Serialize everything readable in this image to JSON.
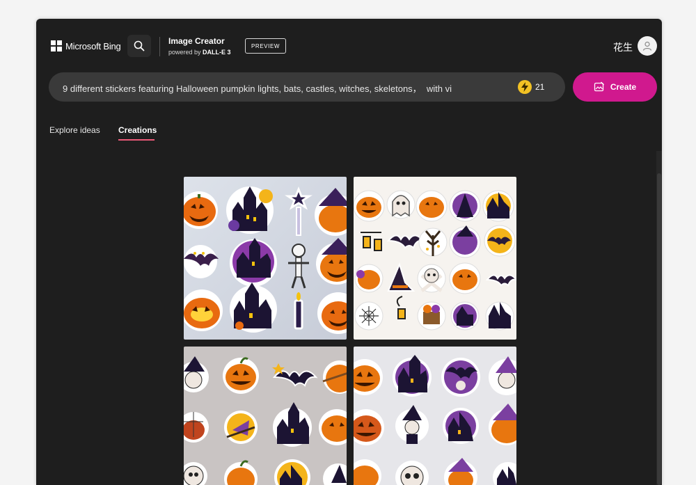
{
  "header": {
    "brand": "Microsoft Bing",
    "search_icon": "search-icon",
    "product_title": "Image Creator",
    "powered_by_prefix": "powered by ",
    "powered_by_model": "DALL-E 3",
    "badge": "PREVIEW",
    "user_name": "花生",
    "avatar_icon": "person-icon"
  },
  "prompt": {
    "text": "9 different stickers featuring Halloween pumpkin lights, bats, castles, witches, skeletons，  with vi",
    "boost_icon": "lightning-icon",
    "boosts": "21",
    "create_label": "Create",
    "create_icon": "image-create-icon"
  },
  "tabs": [
    {
      "label": "Explore ideas",
      "active": false
    },
    {
      "label": "Creations",
      "active": true
    }
  ],
  "colors": {
    "window_bg": "#1e1e1e",
    "prompt_bg": "#3a3a3a",
    "create_button": "#d0198e",
    "tab_underline": "#ec5a78",
    "boost": "#f2c224"
  },
  "images": [
    {
      "name": "halloween-sticker-sheet-1"
    },
    {
      "name": "halloween-sticker-sheet-2"
    },
    {
      "name": "halloween-sticker-sheet-3"
    },
    {
      "name": "halloween-sticker-sheet-4"
    }
  ]
}
